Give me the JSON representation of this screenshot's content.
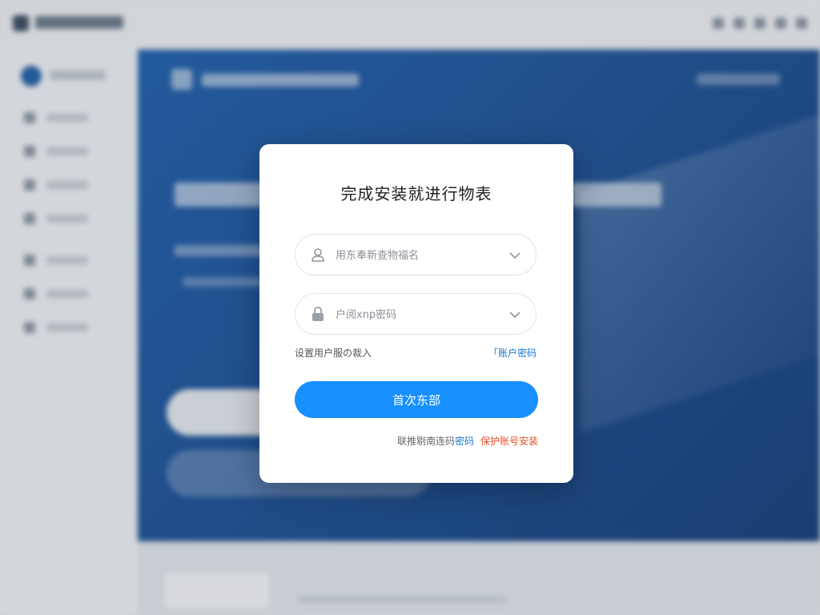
{
  "dialog": {
    "title": "完成安装就进行物表",
    "username": {
      "placeholder": "用东奉新查物福名",
      "value": ""
    },
    "password": {
      "placeholder": "户阅xnp密码",
      "value": ""
    },
    "remember_label": "设置用户服の裁入",
    "forgot_label": "「账户密码",
    "login_button": "首次东部",
    "footer": {
      "prefix": "联推剔南连码",
      "link_password": "密码",
      "link_security": "保护账号安装"
    }
  },
  "colors": {
    "primary_button": "#1890ff",
    "link_blue": "#1677d2",
    "link_red": "#e5502b",
    "hero_blue": "#1e5fae"
  },
  "icons": {
    "username_field": "user-icon",
    "password_field": "lock-icon",
    "dropdown": "chevron-down-icon"
  }
}
